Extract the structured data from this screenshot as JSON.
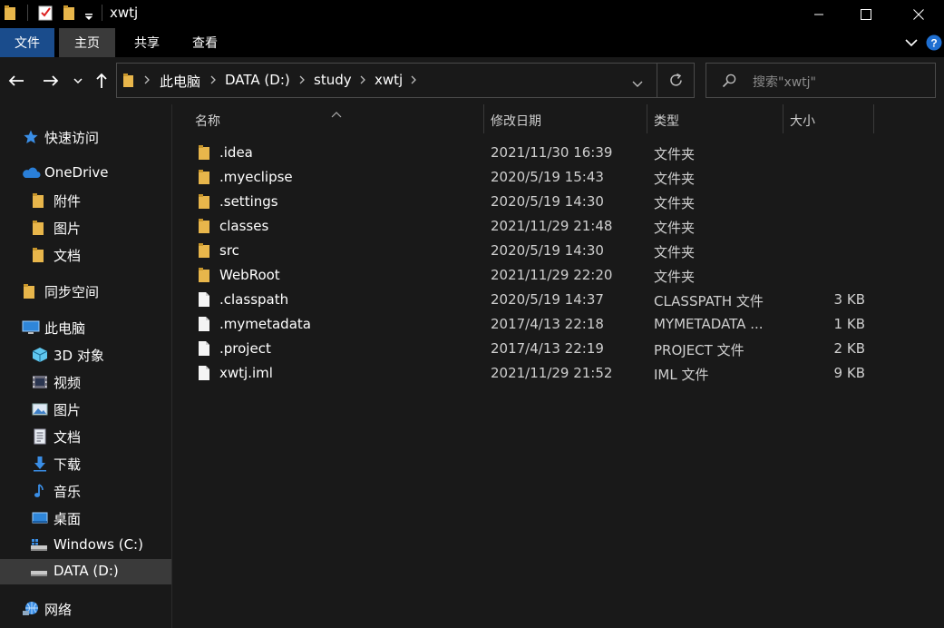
{
  "window": {
    "title": "xwtj"
  },
  "ribbon": {
    "tabs": [
      "文件",
      "主页",
      "共享",
      "查看"
    ]
  },
  "address": {
    "crumbs": [
      "此电脑",
      "DATA (D:)",
      "study",
      "xwtj"
    ],
    "search_placeholder": "搜索\"xwtj\""
  },
  "sidebar": {
    "items": [
      {
        "label": "快速访问",
        "icon": "star-icon"
      },
      {
        "label": "OneDrive",
        "icon": "cloud-icon"
      },
      {
        "label": "附件",
        "icon": "folder-icon"
      },
      {
        "label": "图片",
        "icon": "folder-icon"
      },
      {
        "label": "文档",
        "icon": "folder-icon"
      },
      {
        "label": "同步空间",
        "icon": "folder-icon"
      },
      {
        "label": "此电脑",
        "icon": "computer-icon"
      },
      {
        "label": "3D 对象",
        "icon": "cube-icon"
      },
      {
        "label": "视频",
        "icon": "video-icon"
      },
      {
        "label": "图片",
        "icon": "picture-icon"
      },
      {
        "label": "文档",
        "icon": "document-icon"
      },
      {
        "label": "下载",
        "icon": "download-icon"
      },
      {
        "label": "音乐",
        "icon": "music-icon"
      },
      {
        "label": "桌面",
        "icon": "desktop-icon"
      },
      {
        "label": "Windows (C:)",
        "icon": "windows-drive-icon"
      },
      {
        "label": "DATA (D:)",
        "icon": "drive-icon"
      },
      {
        "label": "网络",
        "icon": "network-icon"
      }
    ]
  },
  "columns": {
    "name": "名称",
    "date": "修改日期",
    "type": "类型",
    "size": "大小"
  },
  "files": [
    {
      "name": ".idea",
      "date": "2021/11/30 16:39",
      "type": "文件夹",
      "size": "",
      "kind": "folder"
    },
    {
      "name": ".myeclipse",
      "date": "2020/5/19 15:43",
      "type": "文件夹",
      "size": "",
      "kind": "folder"
    },
    {
      "name": ".settings",
      "date": "2020/5/19 14:30",
      "type": "文件夹",
      "size": "",
      "kind": "folder"
    },
    {
      "name": "classes",
      "date": "2021/11/29 21:48",
      "type": "文件夹",
      "size": "",
      "kind": "folder"
    },
    {
      "name": "src",
      "date": "2020/5/19 14:30",
      "type": "文件夹",
      "size": "",
      "kind": "folder"
    },
    {
      "name": "WebRoot",
      "date": "2021/11/29 22:20",
      "type": "文件夹",
      "size": "",
      "kind": "folder"
    },
    {
      "name": ".classpath",
      "date": "2020/5/19 14:37",
      "type": "CLASSPATH 文件",
      "size": "3 KB",
      "kind": "file"
    },
    {
      "name": ".mymetadata",
      "date": "2017/4/13 22:18",
      "type": "MYMETADATA ...",
      "size": "1 KB",
      "kind": "file"
    },
    {
      "name": ".project",
      "date": "2017/4/13 22:19",
      "type": "PROJECT 文件",
      "size": "2 KB",
      "kind": "file"
    },
    {
      "name": "xwtj.iml",
      "date": "2021/11/29 21:52",
      "type": "IML 文件",
      "size": "9 KB",
      "kind": "file"
    }
  ],
  "colors": {
    "accent": "#1a4c8c",
    "folder": "#e8b64b",
    "background": "#191919"
  }
}
